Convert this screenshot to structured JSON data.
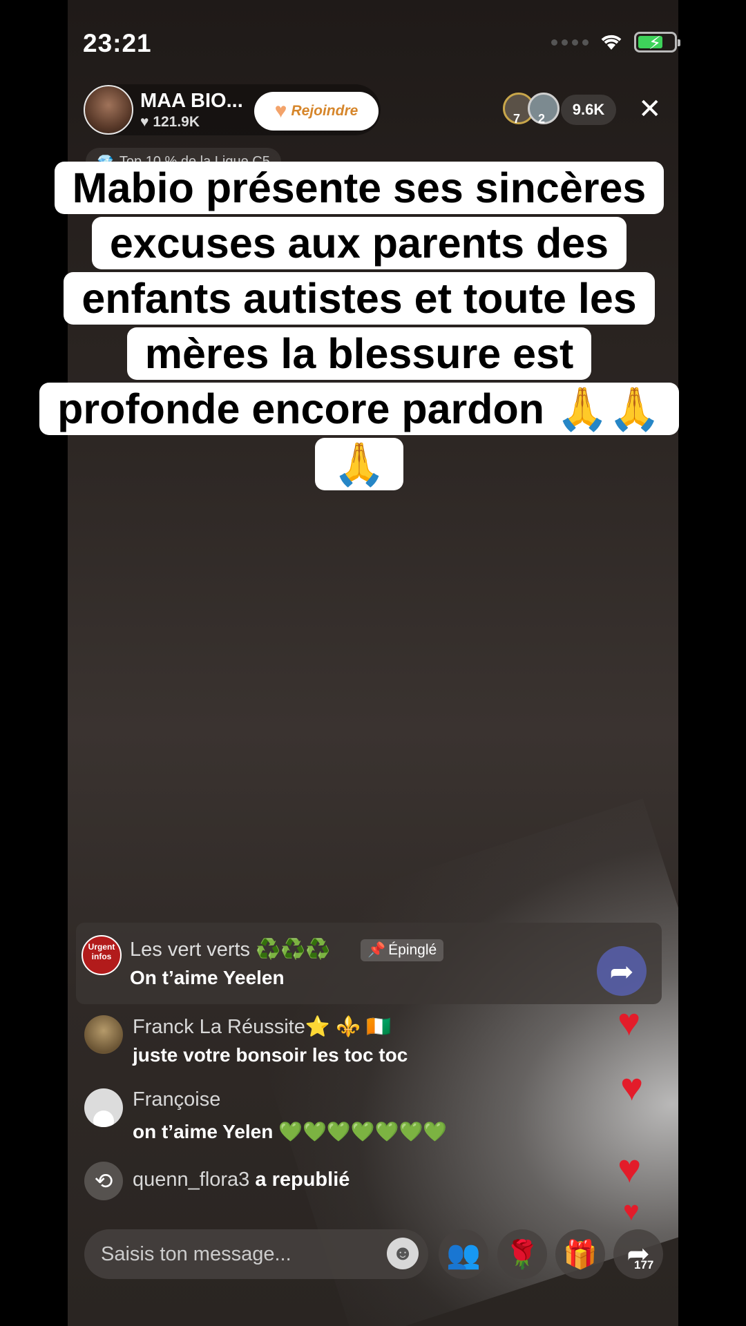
{
  "status_bar": {
    "time": "23:21"
  },
  "host": {
    "name": "MAA BIO...",
    "likes": "121.9K",
    "join_label": "Rejoindre"
  },
  "viewers": {
    "badge_1": "7",
    "badge_2": "2",
    "count": "9.6K"
  },
  "league_badge": "Top 10 % de la Ligue C5",
  "caption": [
    "Mabio présente ses sincères",
    "excuses aux parents des",
    "enfants autistes et toute les",
    "mères la blessure est",
    "profonde encore pardon 🙏🙏",
    "🙏"
  ],
  "pinned": {
    "avatar_text": "Urgent infos",
    "name": "Les vert verts ♻️♻️♻️",
    "tag": "Épinglé",
    "message": "On t’aime Yeelen"
  },
  "comments": [
    {
      "name": "Franck La Réussite⭐ ⚜️ 🇨🇮",
      "message": "juste votre bonsoir les toc toc"
    },
    {
      "name": "Françoise",
      "message": "on t’aime Yelen 💚💚💚💚💚💚💚"
    }
  ],
  "repost": {
    "user": "quenn_flora3",
    "action": "a republié"
  },
  "input": {
    "placeholder": "Saisis ton message..."
  },
  "share_count": "177",
  "colors": {
    "heart": "#e31c2a",
    "join_text": "#d6862b",
    "battery": "#3ed25a"
  }
}
